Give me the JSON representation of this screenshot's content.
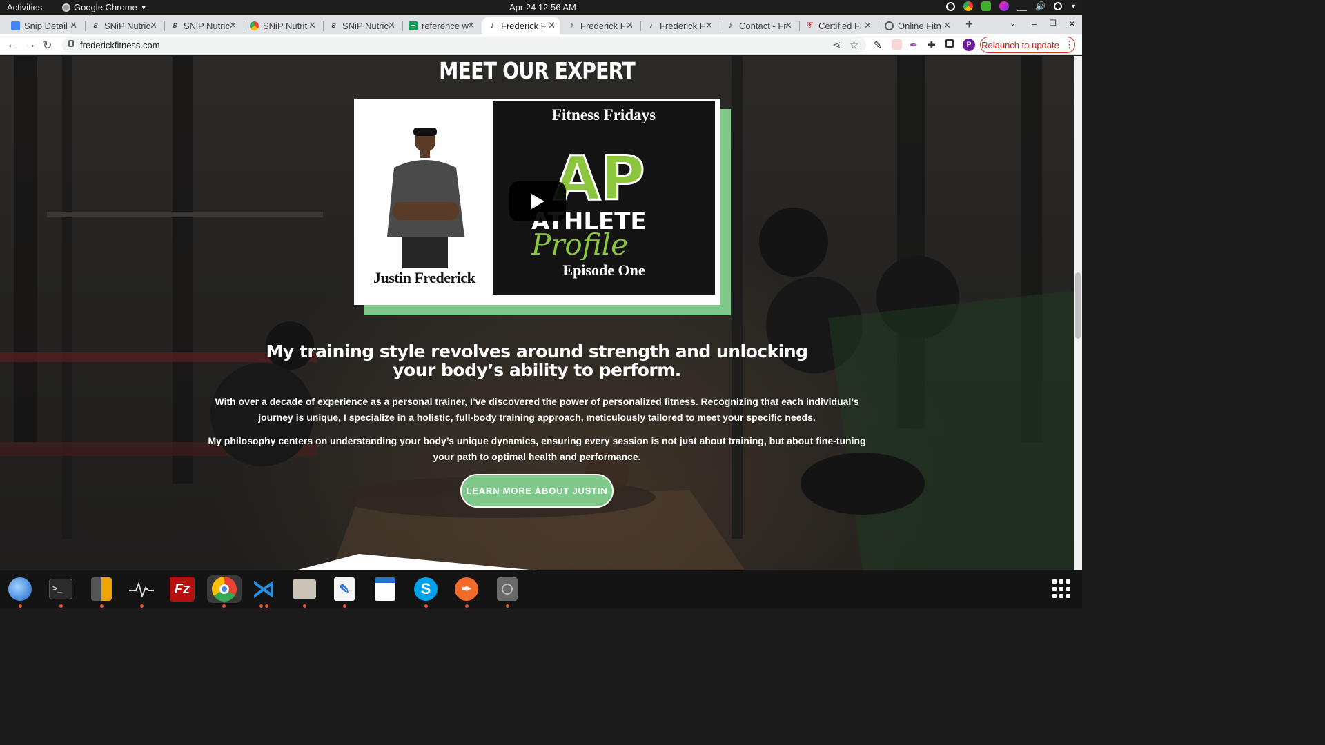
{
  "system": {
    "activities": "Activities",
    "app_name": "Google Chrome",
    "clock": "Apr 24  12:56 AM"
  },
  "browser": {
    "tabs": [
      {
        "title": "Snip Detail",
        "icon": "doc-icon"
      },
      {
        "title": "SNiP Nutric",
        "icon": "snip-icon"
      },
      {
        "title": "SNiP Nutric",
        "icon": "snip-icon"
      },
      {
        "title": "SNiP Nutrit",
        "icon": "snip-google-icon"
      },
      {
        "title": "SNiP Nutric",
        "icon": "snip-icon"
      },
      {
        "title": "reference w",
        "icon": "sheets-icon"
      },
      {
        "title": "Frederick F",
        "icon": "frederick-icon",
        "active": true
      },
      {
        "title": "Frederick F",
        "icon": "frederick-icon"
      },
      {
        "title": "Frederick F",
        "icon": "frederick-icon"
      },
      {
        "title": "Contact - Fr",
        "icon": "frederick-icon"
      },
      {
        "title": "Certified Fi",
        "icon": "certified-icon"
      },
      {
        "title": "Online Fitn",
        "icon": "globe-icon"
      }
    ],
    "url": "frederickfitness.com",
    "relaunch_label": "Relaunch to update",
    "profile_initial": "P"
  },
  "page": {
    "heading": "MEET OUR EXPERT",
    "video": {
      "person_name": "Justin Frederick",
      "series_title": "Fitness Fridays",
      "logo_letters": "AP",
      "logo_word": "ATHLETE",
      "logo_script": "Profile",
      "episode": "Episode One"
    },
    "subheading": "My training style revolves around strength and unlocking your body’s ability to perform.",
    "paragraph_1": "With over a decade of experience as a personal trainer, I’ve discovered the power of personalized fitness. Recognizing that each individual’s journey is unique, I specialize in a holistic, full-body training approach, meticulously tailored to meet your specific needs.",
    "paragraph_2": "My philosophy centers on understanding your body’s unique dynamics, ensuring every session is not just about training, but about fine-tuning your path to optimal health and performance.",
    "cta_label": "LEARN MORE ABOUT JUSTIN",
    "accent_color": "#7fc98b"
  },
  "dock": {
    "apps": [
      "thunderbird-icon",
      "terminal-icon",
      "calculator-icon",
      "system-monitor-icon",
      "filezilla-icon",
      "chrome-icon",
      "vscode-icon",
      "files-icon",
      "text-editor-icon",
      "document-viewer-icon",
      "skype-icon",
      "inkscape-icon",
      "disk-icon"
    ]
  }
}
